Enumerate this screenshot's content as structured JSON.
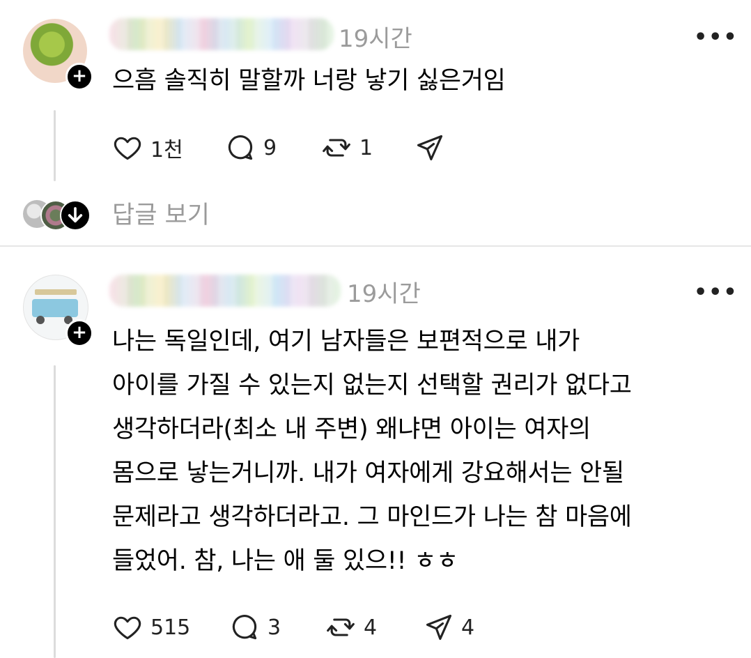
{
  "posts": [
    {
      "time": "19시간",
      "more": "•••",
      "text_lines": [
        "으흠 솔직히 말할까 너랑 낳기 싫은거임"
      ],
      "actions": {
        "likes": "1천",
        "comments": "9",
        "reposts": "1",
        "shares": ""
      }
    },
    {
      "time": "19시간",
      "more": "•••",
      "text_lines": [
        "나는 독일인데, 여기 남자들은 보편적으로 내가",
        "아이를 가질 수 있는지 없는지 선택할 권리가 없다고",
        "생각하더라(최소 내 주변) 왜냐면 아이는 여자의",
        "몸으로 낳는거니까. 내가 여자에게 강요해서는 안될",
        "문제라고 생각하더라고. 그 마인드가 나는 참 마음에",
        "들었어. 참, 나는 애 둘 있으!! ㅎㅎ"
      ],
      "actions": {
        "likes": "515",
        "comments": "3",
        "reposts": "4",
        "shares": "4"
      }
    }
  ],
  "replies_link": "답글 보기",
  "icons": {
    "plus": "plus-icon",
    "heart": "heart-icon",
    "comment": "comment-icon",
    "repost": "repost-icon",
    "share": "send-icon",
    "more": "more-icon",
    "down": "arrow-down-icon"
  },
  "colors": {
    "muted": "#9b9b9b",
    "divider": "#e6e6e6"
  }
}
